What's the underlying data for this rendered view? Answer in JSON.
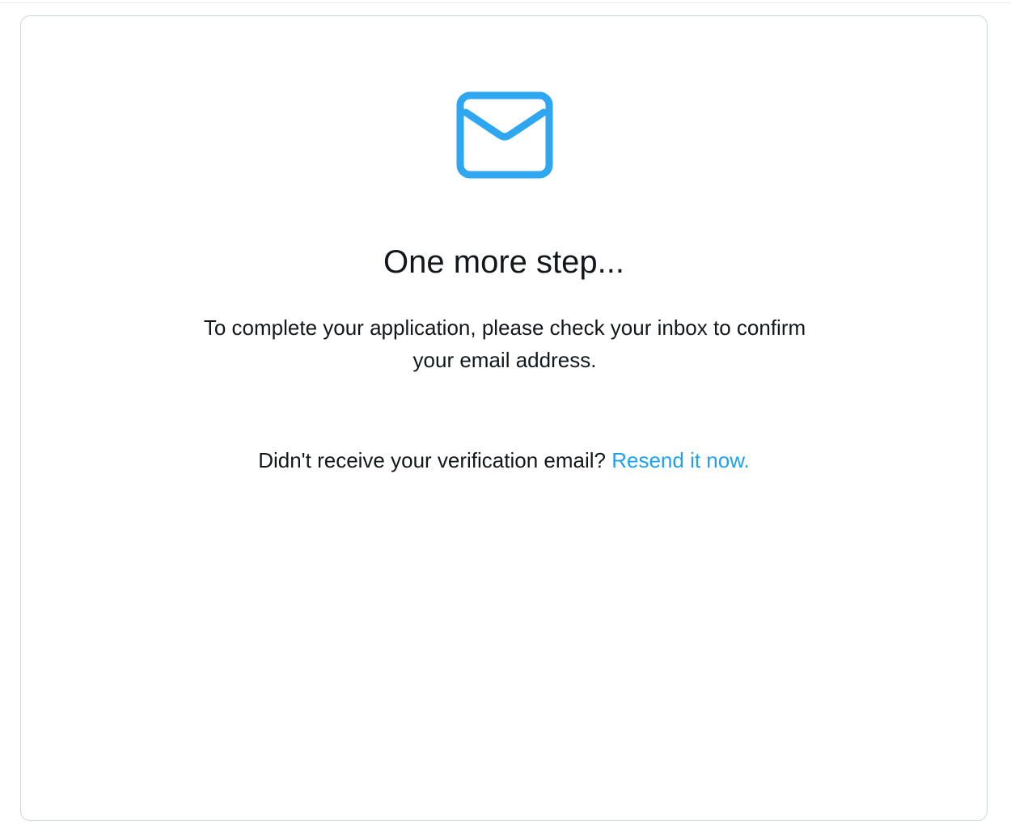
{
  "verification": {
    "heading": "One more step...",
    "message": "To complete your application, please check your inbox to confirm your email address.",
    "resend_prompt": "Didn't receive your verification email?",
    "resend_link": "Resend it now.",
    "icon": "mail-icon"
  },
  "colors": {
    "accent": "#1da1f2",
    "icon": "#2ea6f0",
    "text": "#14171a",
    "card_border": "#ccd6dd"
  }
}
